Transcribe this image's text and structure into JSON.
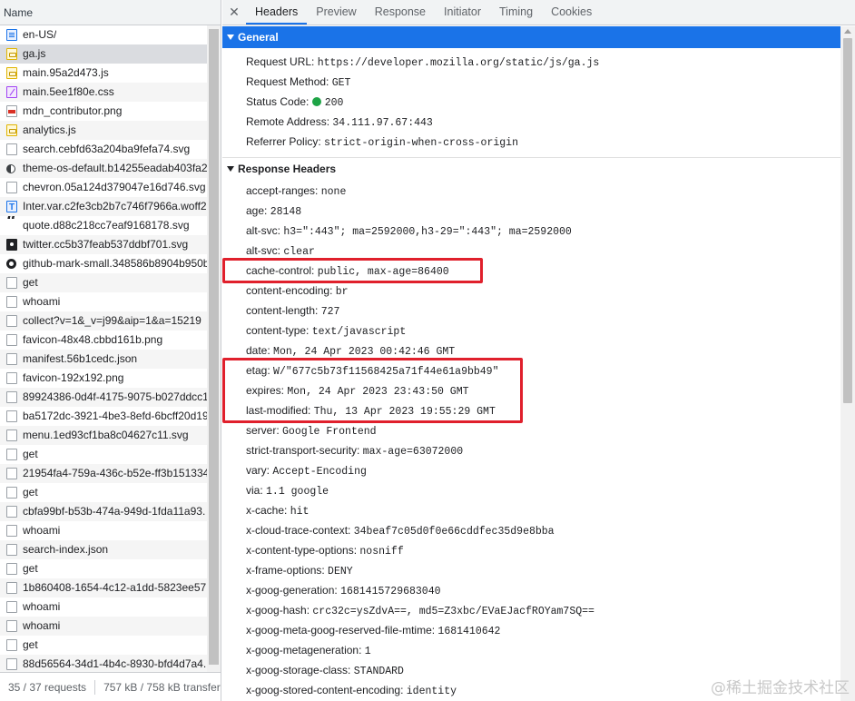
{
  "left": {
    "header": "Name",
    "files": [
      {
        "name": "en-US/",
        "icon": "document-icon",
        "cls": "ic-doc"
      },
      {
        "name": "ga.js",
        "icon": "script-icon",
        "cls": "ic-js",
        "selected": true
      },
      {
        "name": "main.95a2d473.js",
        "icon": "script-icon",
        "cls": "ic-js"
      },
      {
        "name": "main.5ee1f80e.css",
        "icon": "stylesheet-icon",
        "cls": "ic-css"
      },
      {
        "name": "mdn_contributor.png",
        "icon": "image-icon",
        "cls": "ic-img"
      },
      {
        "name": "analytics.js",
        "icon": "script-icon",
        "cls": "ic-js"
      },
      {
        "name": "search.cebfd63a204ba9fefa74.svg",
        "icon": "file-icon",
        "cls": "ic-blank"
      },
      {
        "name": "theme-os-default.b14255eadab403fa2",
        "icon": "theme-icon",
        "cls": "ic-half"
      },
      {
        "name": "chevron.05a124d379047e16d746.svg",
        "icon": "file-icon",
        "cls": "ic-blank"
      },
      {
        "name": "Inter.var.c2fe3cb2b7c746f7966a.woff2",
        "icon": "font-icon",
        "cls": "ic-font"
      },
      {
        "name": "quote.d88c218cc7eaf9168178.svg",
        "icon": "quote-icon",
        "cls": "ic-quote"
      },
      {
        "name": "twitter.cc5b37feab537ddbf701.svg",
        "icon": "twitter-icon",
        "cls": "ic-bird"
      },
      {
        "name": "github-mark-small.348586b8904b950b",
        "icon": "github-icon",
        "cls": "ic-gh"
      },
      {
        "name": "get",
        "icon": "file-icon",
        "cls": "ic-blank"
      },
      {
        "name": "whoami",
        "icon": "file-icon",
        "cls": "ic-blank"
      },
      {
        "name": "collect?v=1&_v=j99&aip=1&a=15219",
        "icon": "file-icon",
        "cls": "ic-blank"
      },
      {
        "name": "favicon-48x48.cbbd161b.png",
        "icon": "file-icon",
        "cls": "ic-blank"
      },
      {
        "name": "manifest.56b1cedc.json",
        "icon": "file-icon",
        "cls": "ic-blank"
      },
      {
        "name": "favicon-192x192.png",
        "icon": "file-icon",
        "cls": "ic-blank"
      },
      {
        "name": "89924386-0d4f-4175-9075-b027ddcc1",
        "icon": "file-icon",
        "cls": "ic-blank"
      },
      {
        "name": "ba5172dc-3921-4be3-8efd-6bcff20d19",
        "icon": "file-icon",
        "cls": "ic-blank"
      },
      {
        "name": "menu.1ed93cf1ba8c04627c11.svg",
        "icon": "file-icon",
        "cls": "ic-blank"
      },
      {
        "name": "get",
        "icon": "file-icon",
        "cls": "ic-blank"
      },
      {
        "name": "21954fa4-759a-436c-b52e-ff3b151334",
        "icon": "file-icon",
        "cls": "ic-blank"
      },
      {
        "name": "get",
        "icon": "file-icon",
        "cls": "ic-blank"
      },
      {
        "name": "cbfa99bf-b53b-474a-949d-1fda11a93.",
        "icon": "file-icon",
        "cls": "ic-blank"
      },
      {
        "name": "whoami",
        "icon": "file-icon",
        "cls": "ic-blank"
      },
      {
        "name": "search-index.json",
        "icon": "file-icon",
        "cls": "ic-blank"
      },
      {
        "name": "get",
        "icon": "file-icon",
        "cls": "ic-blank"
      },
      {
        "name": "1b860408-1654-4c12-a1dd-5823ee57.",
        "icon": "file-icon",
        "cls": "ic-blank"
      },
      {
        "name": "whoami",
        "icon": "file-icon",
        "cls": "ic-blank"
      },
      {
        "name": "whoami",
        "icon": "file-icon",
        "cls": "ic-blank"
      },
      {
        "name": "get",
        "icon": "file-icon",
        "cls": "ic-blank"
      },
      {
        "name": "88d56564-34d1-4b4c-8930-bfd4d7a4.",
        "icon": "file-icon",
        "cls": "ic-blank"
      }
    ],
    "status": {
      "requests": "35 / 37 requests",
      "transferred": "757 kB / 758 kB transferr"
    }
  },
  "tabs": {
    "close": "✕",
    "items": [
      "Headers",
      "Preview",
      "Response",
      "Initiator",
      "Timing",
      "Cookies"
    ],
    "active": "Headers"
  },
  "general": {
    "title": "General",
    "rows": [
      {
        "key": "Request URL:",
        "value": "https://developer.mozilla.org/static/js/ga.js"
      },
      {
        "key": "Request Method:",
        "value": "GET"
      },
      {
        "key": "Status Code:",
        "value": "200",
        "dot": true
      },
      {
        "key": "Remote Address:",
        "value": "34.111.97.67:443"
      },
      {
        "key": "Referrer Policy:",
        "value": "strict-origin-when-cross-origin"
      }
    ]
  },
  "response_headers": {
    "title": "Response Headers",
    "rows": [
      {
        "key": "accept-ranges:",
        "value": "none"
      },
      {
        "key": "age:",
        "value": "28148"
      },
      {
        "key": "alt-svc:",
        "value": "h3=\":443\"; ma=2592000,h3-29=\":443\"; ma=2592000"
      },
      {
        "key": "alt-svc:",
        "value": "clear"
      },
      {
        "key": "cache-control:",
        "value": "public, max-age=86400"
      },
      {
        "key": "content-encoding:",
        "value": "br"
      },
      {
        "key": "content-length:",
        "value": "727"
      },
      {
        "key": "content-type:",
        "value": "text/javascript"
      },
      {
        "key": "date:",
        "value": "Mon, 24 Apr 2023 00:42:46 GMT"
      },
      {
        "key": "etag:",
        "value": "W/\"677c5b73f11568425a71f44e61a9bb49\""
      },
      {
        "key": "expires:",
        "value": "Mon, 24 Apr 2023 23:43:50 GMT"
      },
      {
        "key": "last-modified:",
        "value": "Thu, 13 Apr 2023 19:55:29 GMT"
      },
      {
        "key": "server:",
        "value": "Google Frontend"
      },
      {
        "key": "strict-transport-security:",
        "value": "max-age=63072000"
      },
      {
        "key": "vary:",
        "value": "Accept-Encoding"
      },
      {
        "key": "via:",
        "value": "1.1 google"
      },
      {
        "key": "x-cache:",
        "value": "hit"
      },
      {
        "key": "x-cloud-trace-context:",
        "value": "34beaf7c05d0f0e66cddfec35d9e8bba"
      },
      {
        "key": "x-content-type-options:",
        "value": "nosniff"
      },
      {
        "key": "x-frame-options:",
        "value": "DENY"
      },
      {
        "key": "x-goog-generation:",
        "value": "1681415729683040"
      },
      {
        "key": "x-goog-hash:",
        "value": "crc32c=ysZdvA==, md5=Z3xbc/EVaEJacfROYam7SQ=="
      },
      {
        "key": "x-goog-meta-goog-reserved-file-mtime:",
        "value": "1681410642"
      },
      {
        "key": "x-goog-metageneration:",
        "value": "1"
      },
      {
        "key": "x-goog-storage-class:",
        "value": "STANDARD"
      },
      {
        "key": "x-goog-stored-content-encoding:",
        "value": "identity"
      }
    ]
  },
  "colors": {
    "accent": "#1a73e8",
    "highlight_box": "#e0202c",
    "status_ok": "#1ea446"
  },
  "watermark": "@稀土掘金技术社区"
}
